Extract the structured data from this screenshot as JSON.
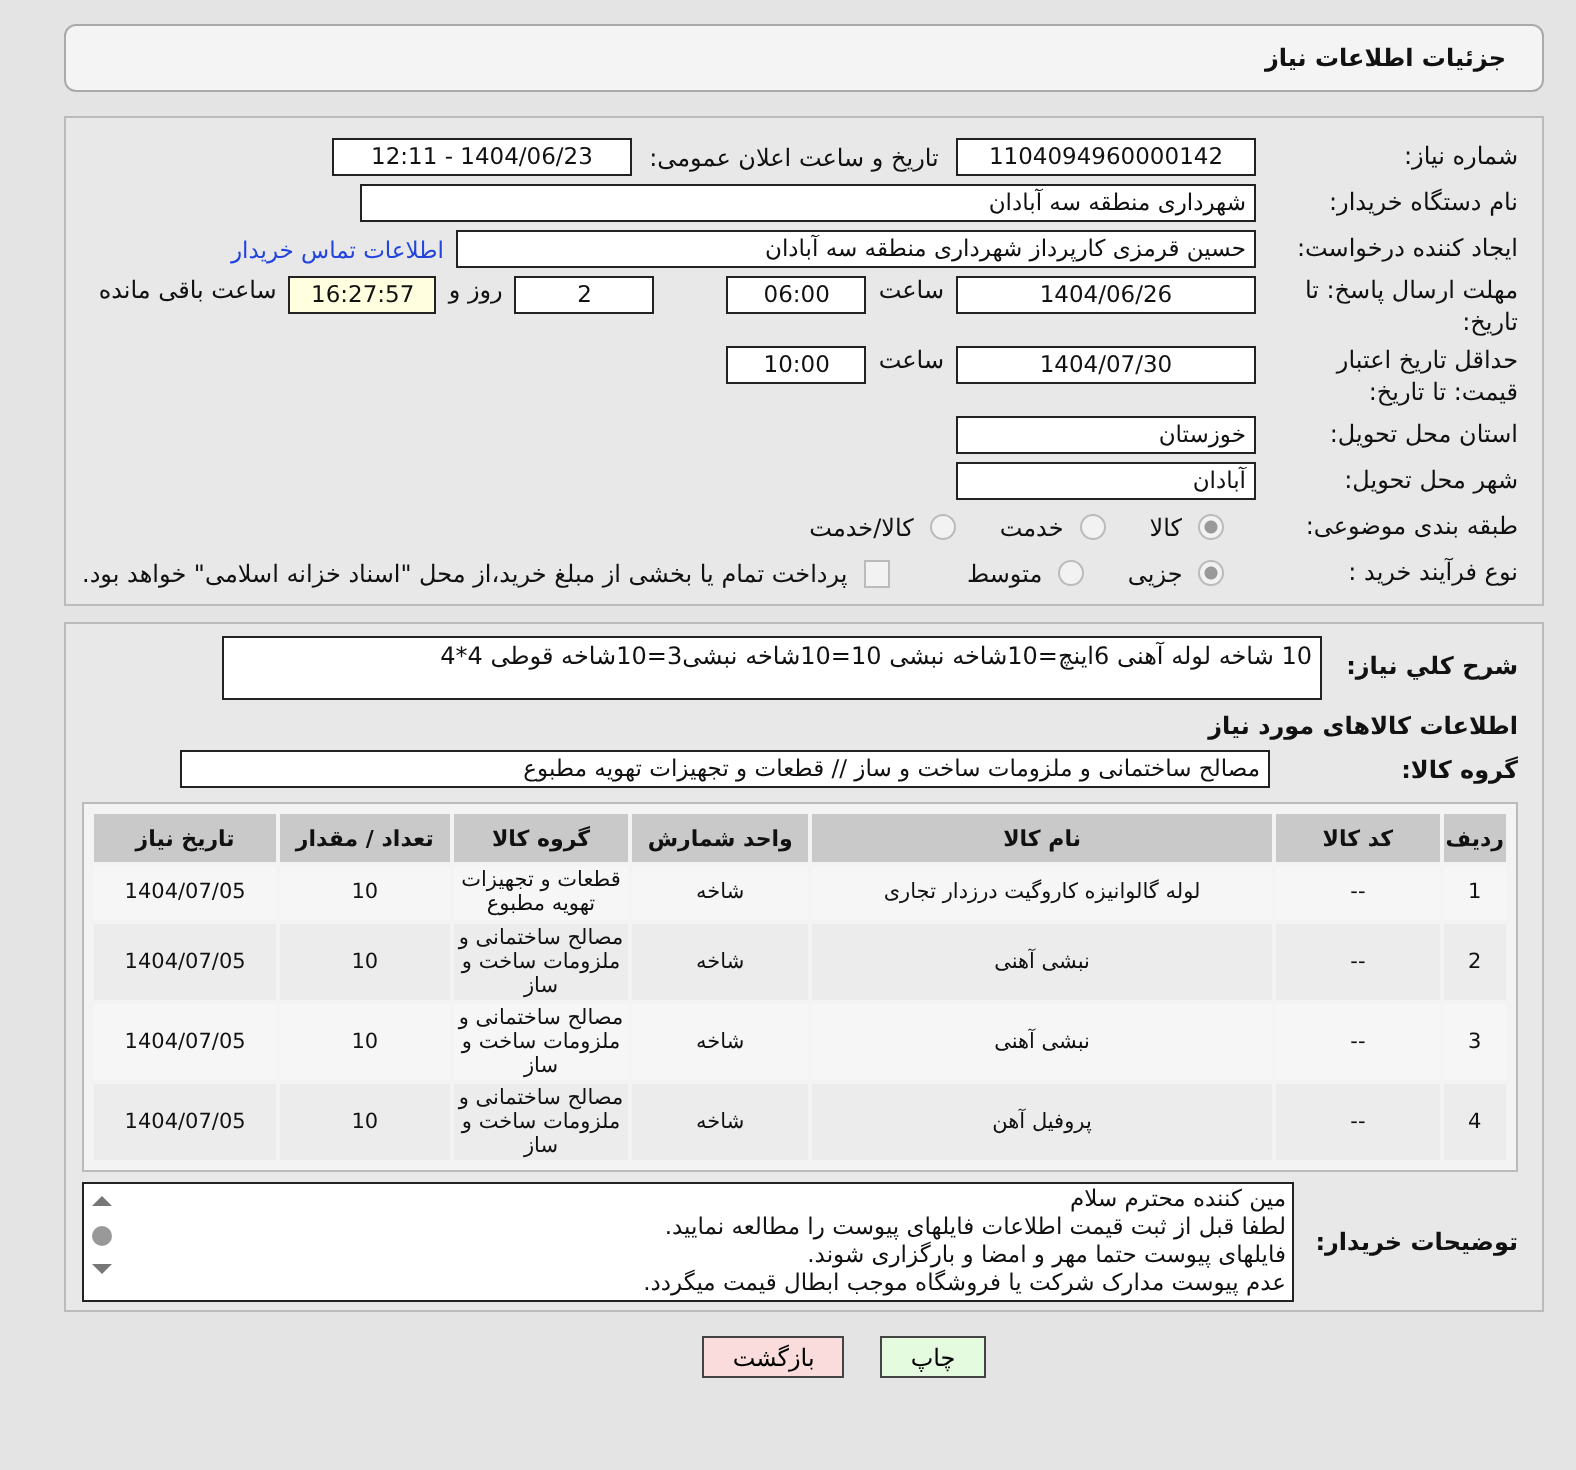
{
  "header": {
    "title": "جزئیات اطلاعات نیاز"
  },
  "need_number": {
    "label": "شماره نیاز:",
    "value": "1104094960000142"
  },
  "announce": {
    "label": "تاریخ و ساعت اعلان عمومی:",
    "value": "1404/06/23 - 12:11"
  },
  "buyer": {
    "label": "نام دستگاه خریدار:",
    "value": "شهرداری منطقه سه آبادان"
  },
  "requester": {
    "label": "ایجاد کننده درخواست:",
    "value": "حسین قرمزی کارپرداز شهرداری منطقه سه آبادان",
    "link": "اطلاعات تماس خریدار"
  },
  "deadline": {
    "label": "مهلت ارسال پاسخ: تا تاریخ:",
    "date": "1404/06/26",
    "time_label": "ساعت",
    "time": "06:00",
    "days": "2",
    "days_label": "روز و",
    "remaining": "16:27:57",
    "remaining_label": "ساعت باقی مانده"
  },
  "validity": {
    "label": "حداقل تاریخ اعتبار قیمت: تا تاریخ:",
    "date": "1404/07/30",
    "time_label": "ساعت",
    "time": "10:00"
  },
  "province": {
    "label": "استان محل تحویل:",
    "value": "خوزستان"
  },
  "city": {
    "label": "شهر محل تحویل:",
    "value": "آبادان"
  },
  "category": {
    "label": "طبقه بندی موضوعی:",
    "options": [
      {
        "label": "کالا",
        "selected": true
      },
      {
        "label": "خدمت",
        "selected": false
      },
      {
        "label": "کالا/خدمت",
        "selected": false
      }
    ]
  },
  "purchase": {
    "label": "نوع فرآیند خرید :",
    "options": [
      {
        "label": "جزیی",
        "selected": true
      },
      {
        "label": "متوسط",
        "selected": false
      }
    ],
    "payment": {
      "label": "پرداخت تمام یا بخشی از مبلغ خرید،از محل \"اسناد خزانه اسلامی\" خواهد بود.",
      "checked": false
    }
  },
  "description": {
    "label": "شرح کلي نياز:",
    "value": "10 شاخه لوله آهنی 6اینچ=10شاخه نبشی 10=10شاخه نبشی3=10شاخه قوطی 4*4"
  },
  "goods_title": "اطلاعات کالاهای مورد نیاز",
  "goods_group": {
    "label": "گروه کالا:",
    "value": "مصالح ساختمانی و ملزومات ساخت و ساز //  قطعات و تجهیزات تهویه مطبوع"
  },
  "table": {
    "columns": [
      "ردیف",
      "کد کالا",
      "نام کالا",
      "واحد شمارش",
      "گروه کالا",
      "تعداد / مقدار",
      "تاریخ نیاز"
    ],
    "rows": [
      [
        "1",
        "--",
        "لوله گالوانیزه کاروگیت درزدار تجاری",
        "شاخه",
        "قطعات و تجهیزات تهویه مطبوع",
        "10",
        "1404/07/05"
      ],
      [
        "2",
        "--",
        "نبشی آهنی",
        "شاخه",
        "مصالح ساختمانی و ملزومات ساخت و ساز",
        "10",
        "1404/07/05"
      ],
      [
        "3",
        "--",
        "نبشی آهنی",
        "شاخه",
        "مصالح ساختمانی و ملزومات ساخت و ساز",
        "10",
        "1404/07/05"
      ],
      [
        "4",
        "--",
        "پروفیل آهن",
        "شاخه",
        "مصالح ساختمانی و ملزومات ساخت و ساز",
        "10",
        "1404/07/05"
      ]
    ]
  },
  "notes": {
    "label": "توضیحات خریدار:",
    "lines": [
      "مین کننده محترم سلام",
      "لطفا قبل از ثبت قیمت اطلاعات فایلهای پیوست را مطالعه نمایید.",
      "فایلهای پیوست حتما مهر و امضا و بارگزاری شوند.",
      "عدم پیوست مدارک شرکت یا فروشگاه موجب ابطال قیمت میگردد."
    ]
  },
  "buttons": [
    {
      "label": "چاپ",
      "kind": "print"
    },
    {
      "label": "بازگشت",
      "kind": "back"
    }
  ]
}
